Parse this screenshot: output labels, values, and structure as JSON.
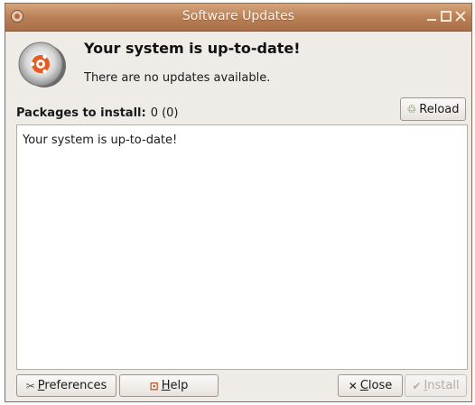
{
  "window": {
    "title": "Software Updates"
  },
  "header": {
    "headline": "Your system is up-to-date!",
    "subline": "There are no updates available."
  },
  "packages": {
    "label": "Packages to install:",
    "count": "0 (0)"
  },
  "toolbar": {
    "reload_label": "Reload"
  },
  "content": {
    "message": "Your system is up-to-date!"
  },
  "buttons": {
    "preferences": "Preferences",
    "help": "Help",
    "close": "Close",
    "install": "Install"
  },
  "icons": {
    "app": "update-manager-icon",
    "header": "system-update-disc-icon",
    "reload": "refresh-icon",
    "preferences": "preferences-icon",
    "help": "help-icon",
    "close": "close-x-icon",
    "install": "checkmark-icon"
  },
  "colors": {
    "titlebar": "#b77d55",
    "window_bg": "#efebe7",
    "accent": "#d9632a"
  }
}
